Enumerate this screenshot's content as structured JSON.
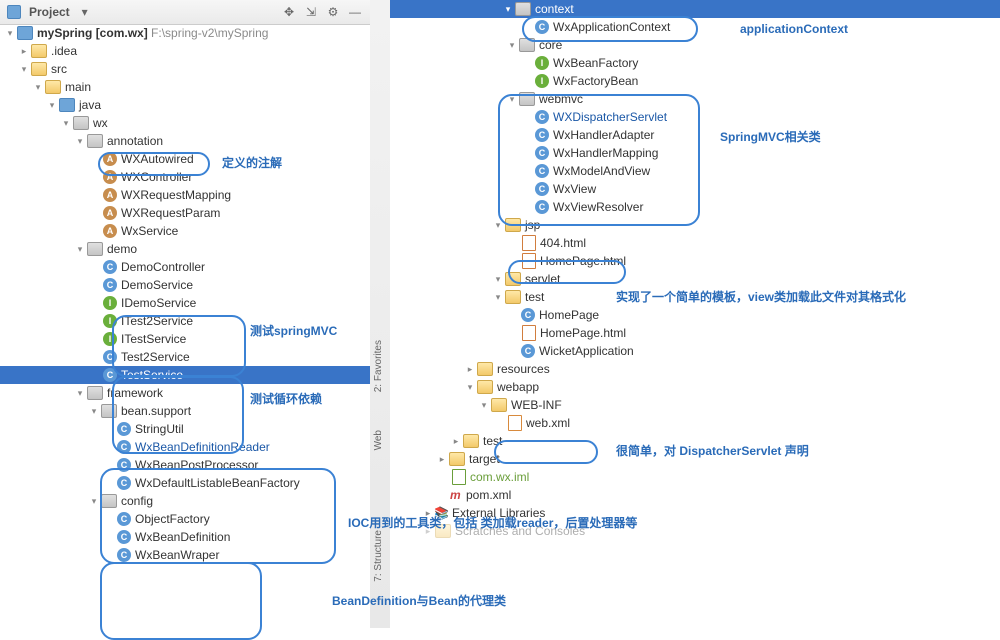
{
  "header": {
    "title": "Project",
    "dropdown_icon": "chevron-down",
    "collapse_icon": "collapse",
    "gear_icon": "gear",
    "hide_icon": "hide"
  },
  "left": {
    "root": {
      "name": "mySpring",
      "bracket": "[com.wx]",
      "path": "F:\\spring-v2\\mySpring"
    },
    "n_idea": ".idea",
    "n_src": "src",
    "n_main": "main",
    "n_java": "java",
    "n_wx": "wx",
    "annotation": "annotation",
    "anns": [
      "WXAutowired",
      "WXController",
      "WXRequestMapping",
      "WXRequestParam",
      "WxService"
    ],
    "demo": "demo",
    "demo_items1": [
      "DemoController",
      "DemoService",
      "IDemoService"
    ],
    "demo_items2": [
      "ITest2Service",
      "ITestService",
      "Test2Service",
      "TestService"
    ],
    "framework": "framework",
    "bean_support": "bean.support",
    "bs_items": [
      "StringUtil",
      "WxBeanDefinitionReader",
      "WxBeanPostProcessor",
      "WxDefaultListableBeanFactory"
    ],
    "config": "config",
    "cfg_items": [
      "ObjectFactory",
      "WxBeanDefinition",
      "WxBeanWraper"
    ]
  },
  "right": {
    "context": "context",
    "context_cls": "WxApplicationContext",
    "core": "core",
    "core_items": [
      "WxBeanFactory",
      "WxFactoryBean"
    ],
    "webmvc": "webmvc",
    "webmvc_items": [
      "WXDispatcherServlet",
      "WxHandlerAdapter",
      "WxHandlerMapping",
      "WxModelAndView",
      "WxView",
      "WxViewResolver"
    ],
    "jsp": "jsp",
    "jsp_files": [
      "404.html",
      "HomePage.html"
    ],
    "servlet": "servlet",
    "test": "test",
    "srv_items": [
      "HomePage",
      "HomePage.html",
      "WicketApplication"
    ],
    "resources": "resources",
    "webapp": "webapp",
    "webinf": "WEB-INF",
    "webxml": "web.xml",
    "test2": "test",
    "target": "target",
    "iml": "com.wx.iml",
    "pom": "pom.xml",
    "libs": "External Libraries",
    "scratches": "Scratches and Consoles"
  },
  "lab": {
    "ann": "定义的注解",
    "mvc": "测试springMVC",
    "loop": "测试循环依赖",
    "ioc": "IOC用到的工具类，包括 类加载reader，后置处理器等",
    "bd": "BeanDefinition与Bean的代理类",
    "appctx": "applicationContext",
    "smvc": "SpringMVC相关类",
    "tpl": "实现了一个简单的模板，view类加载此文件对其格式化",
    "webxml": "很简单，对 DispatcherServlet 声明"
  },
  "tabs": {
    "fav": "2: Favorites",
    "web": "Web",
    "str": "7: Structure"
  }
}
